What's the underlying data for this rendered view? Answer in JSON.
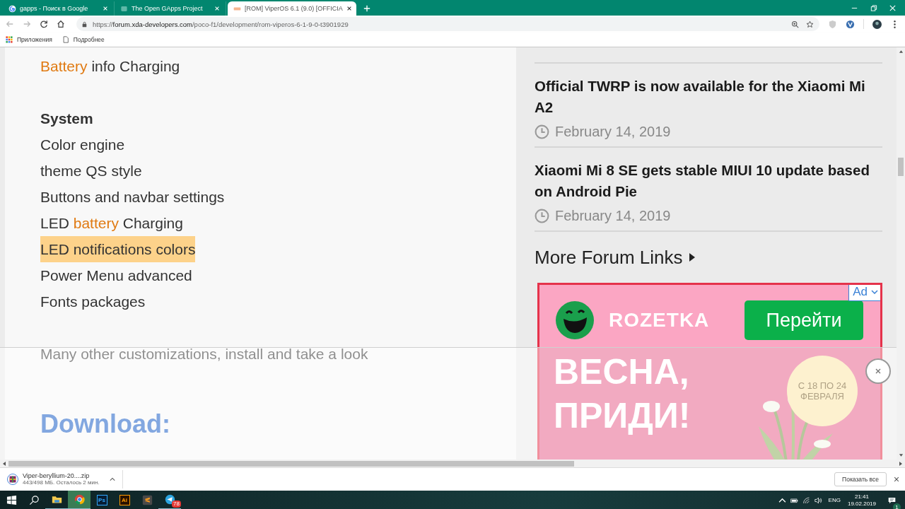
{
  "browser": {
    "tabs": [
      {
        "title": "gapps - Поиск в Google",
        "kind": "google",
        "selected": false
      },
      {
        "title": "The Open GApps Project",
        "kind": "gapps",
        "selected": false
      },
      {
        "title": "[ROM] ViperOS 6.1 (9.0) [OFFICIA",
        "kind": "xda",
        "selected": true
      }
    ],
    "url": {
      "scheme": "https://",
      "host": "forum.xda-developers.com",
      "path": "/poco-f1/development/rom-viperos-6-1-9-0-t3901929"
    },
    "bookmarks": [
      {
        "label": "Приложения",
        "kind": "apps"
      },
      {
        "label": "Подробнее",
        "kind": "page"
      }
    ]
  },
  "article": {
    "sections": [
      {
        "items": [
          {
            "parts": [
              {
                "text": "Battery",
                "link": true
              },
              {
                "text": "info Charging",
                "link": false
              }
            ],
            "highlighted": false
          }
        ]
      },
      {
        "heading": "System",
        "items": [
          {
            "parts": [
              {
                "text": "Color engine",
                "link": false
              }
            ],
            "highlighted": false
          },
          {
            "parts": [
              {
                "text": "theme QS style",
                "link": false
              }
            ],
            "highlighted": false
          },
          {
            "parts": [
              {
                "text": "Buttons and navbar settings",
                "link": false
              }
            ],
            "highlighted": false
          },
          {
            "parts": [
              {
                "text": "LED",
                "link": false
              },
              {
                "text": "battery",
                "link": true
              },
              {
                "text": "Charging",
                "link": false
              }
            ],
            "highlighted": false
          },
          {
            "parts": [
              {
                "text": "LED notifications colors",
                "link": false
              }
            ],
            "highlighted": true
          },
          {
            "parts": [
              {
                "text": "Power Menu advanced",
                "link": false
              }
            ],
            "highlighted": false
          },
          {
            "parts": [
              {
                "text": "Fonts packages",
                "link": false
              }
            ],
            "highlighted": false
          }
        ]
      },
      {
        "items": [
          {
            "parts": [
              {
                "text": "Many other customizations, install and take a look",
                "link": false
              }
            ],
            "highlighted": false
          }
        ]
      }
    ],
    "download_heading": "Download:"
  },
  "sidebar": {
    "news": [
      {
        "title": "Official TWRP is now available for the Xiaomi Mi A2",
        "date": "February 14, 2019"
      },
      {
        "title": "Xiaomi Mi 8 SE gets stable MIUI 10 update based on Android Pie",
        "date": "February 14, 2019"
      }
    ],
    "more_links": "More Forum Links",
    "ad": {
      "badge": "Ad",
      "brand": "ROZETKA",
      "button": "Перейти",
      "headline": [
        "ВЕСНА,",
        "ПРИДИ!"
      ],
      "dates": "С 18 ПО 24 ФЕВРАЛЯ"
    }
  },
  "downloads": {
    "file": "Viper-beryllium-20....zip",
    "status": "443/498 МБ. Осталось 2 мин.",
    "show_all": "Показать все"
  },
  "taskbar": {
    "apps": [
      {
        "kind": "explorer",
        "running": true,
        "active": false
      },
      {
        "kind": "chrome",
        "running": true,
        "active": true
      },
      {
        "kind": "photoshop",
        "label": "Ps",
        "running": false,
        "active": false
      },
      {
        "kind": "illustrator",
        "label": "Ai",
        "running": false,
        "active": false
      },
      {
        "kind": "sublime",
        "running": false,
        "active": false
      },
      {
        "kind": "telegram",
        "badge": "78",
        "running": true,
        "active": false
      }
    ],
    "tray": {
      "language": "ENG",
      "time": "21:41",
      "date": "19.02.2019",
      "notifications": "1"
    }
  }
}
